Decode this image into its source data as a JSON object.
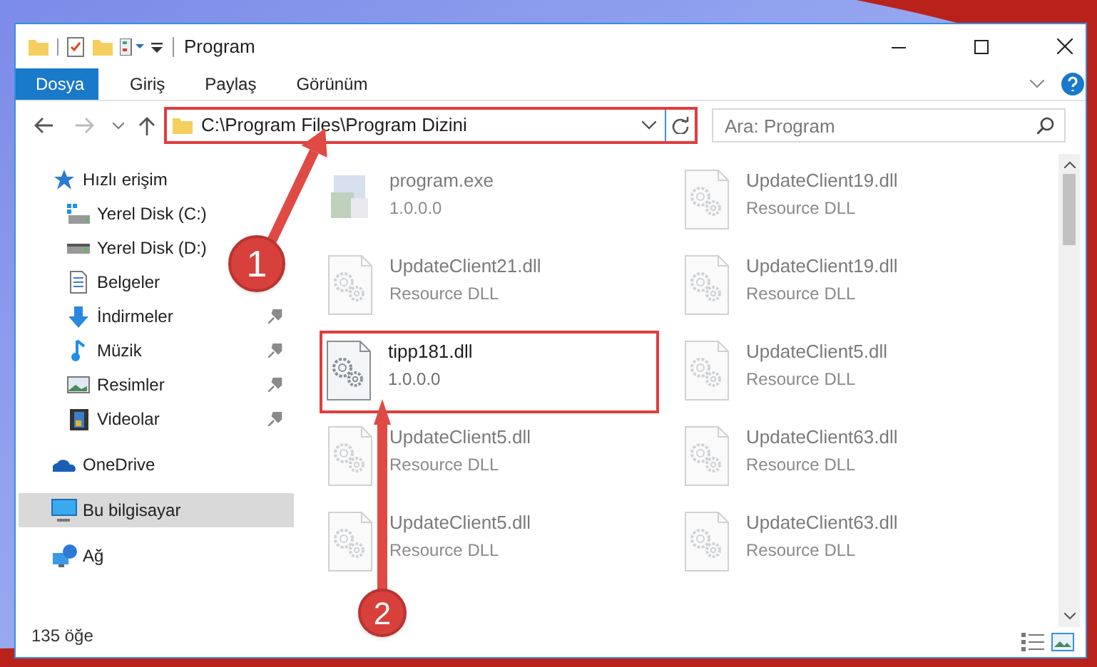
{
  "window": {
    "title": "Program"
  },
  "ribbon_tabs": [
    {
      "label": "Dosya",
      "selected": true
    },
    {
      "label": "Giriş",
      "selected": false
    },
    {
      "label": "Paylaş",
      "selected": false
    },
    {
      "label": "Görünüm",
      "selected": false
    }
  ],
  "address_bar": {
    "path": "C:\\Program Files\\Program Dizini",
    "highlighted": true
  },
  "search": {
    "placeholder": "Ara: Program"
  },
  "navigation": [
    {
      "label": "Hızlı erişim",
      "kind": "star",
      "selected": false,
      "children": [
        {
          "label": "Yerel Disk (C:)",
          "kind": "system_drive",
          "pinned": false,
          "selected": false
        },
        {
          "label": "Yerel Disk (D:)",
          "kind": "drive",
          "pinned": false,
          "selected": false
        },
        {
          "label": "Belgeler",
          "kind": "documents",
          "pinned": false,
          "selected": false
        },
        {
          "label": "İndirmeler",
          "kind": "downloads",
          "pinned": true,
          "selected": false
        },
        {
          "label": "Müzik",
          "kind": "music",
          "pinned": true,
          "selected": false
        },
        {
          "label": "Resimler",
          "kind": "pictures",
          "pinned": true,
          "selected": false
        },
        {
          "label": "Videolar",
          "kind": "videos",
          "pinned": true,
          "selected": false
        }
      ]
    },
    {
      "label": "OneDrive",
      "kind": "cloud",
      "selected": false
    },
    {
      "label": "Bu bilgisayar",
      "kind": "computer",
      "selected": true
    },
    {
      "label": "Ağ",
      "kind": "network",
      "selected": false
    }
  ],
  "files": [
    {
      "name": "program.exe",
      "detail": "1.0.0.0",
      "kind": "exe",
      "blurred": true,
      "highlighted": false
    },
    {
      "name": "UpdateClient19.dll",
      "detail": "Resource DLL",
      "kind": "dll",
      "blurred": true,
      "highlighted": false
    },
    {
      "name": "UpdateClient21.dll",
      "detail": "Resource DLL",
      "kind": "dll",
      "blurred": true,
      "highlighted": false
    },
    {
      "name": "UpdateClient19.dll",
      "detail": "Resource DLL",
      "kind": "dll",
      "blurred": true,
      "highlighted": false
    },
    {
      "name": "tipp181.dll",
      "detail": "1.0.0.0",
      "kind": "dll",
      "blurred": false,
      "highlighted": true
    },
    {
      "name": "UpdateClient5.dll",
      "detail": "Resource DLL",
      "kind": "dll",
      "blurred": true,
      "highlighted": false
    },
    {
      "name": "UpdateClient5.dll",
      "detail": "Resource DLL",
      "kind": "dll",
      "blurred": true,
      "highlighted": false
    },
    {
      "name": "UpdateClient63.dll",
      "detail": "Resource DLL",
      "kind": "dll",
      "blurred": true,
      "highlighted": false
    },
    {
      "name": "UpdateClient5.dll",
      "detail": "Resource DLL",
      "kind": "dll",
      "blurred": true,
      "highlighted": false
    },
    {
      "name": "UpdateClient63.dll",
      "detail": "Resource DLL",
      "kind": "dll",
      "blurred": true,
      "highlighted": false
    }
  ],
  "annotations": [
    {
      "number": "1"
    },
    {
      "number": "2"
    }
  ],
  "status_bar": {
    "item_count": "135 öğe"
  }
}
